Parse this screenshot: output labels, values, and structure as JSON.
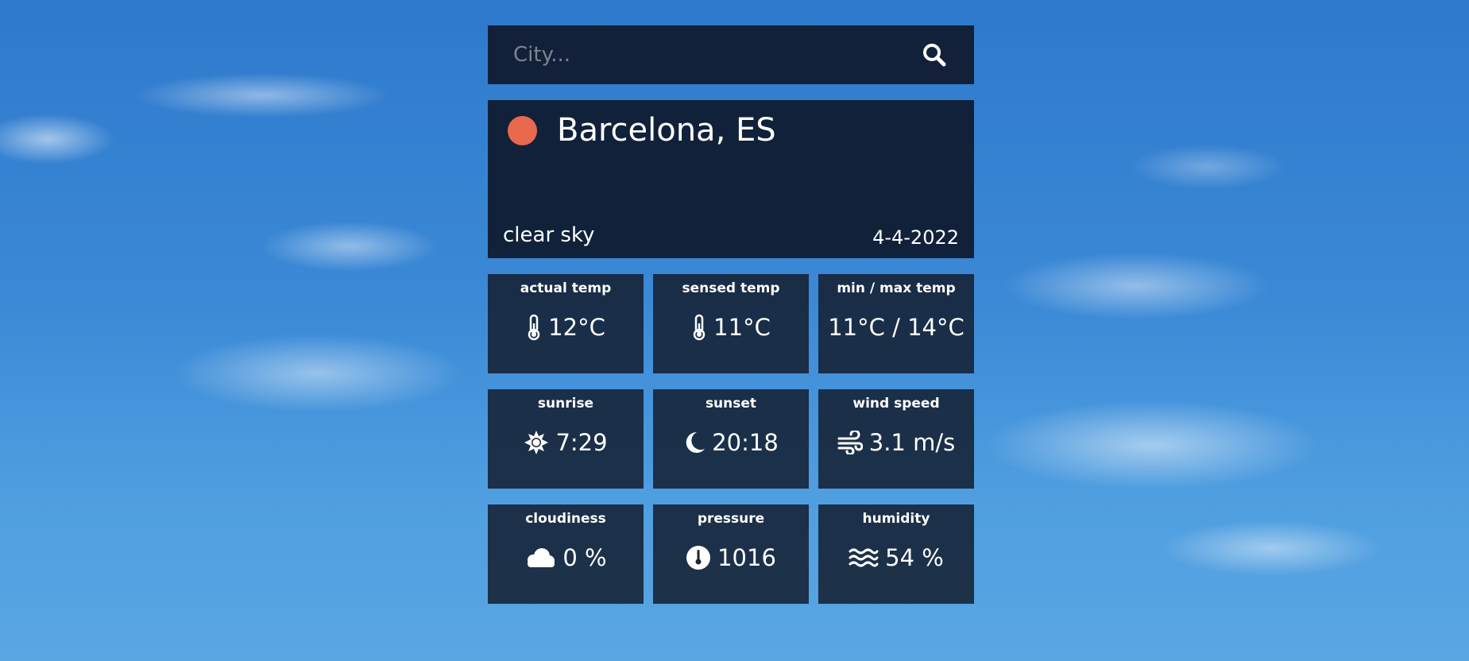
{
  "search": {
    "placeholder": "City...",
    "icon": "search-icon"
  },
  "current": {
    "city": "Barcelona, ES",
    "description": "clear sky",
    "date": "4-4-2022",
    "status_color": "#e8694d"
  },
  "tiles": [
    {
      "label": "actual temp",
      "value": "12°C",
      "icon": "thermometer-icon"
    },
    {
      "label": "sensed temp",
      "value": "11°C",
      "icon": "thermometer-icon"
    },
    {
      "label": "min / max temp",
      "value": "11°C / 14°C",
      "icon": ""
    },
    {
      "label": "sunrise",
      "value": "7:29",
      "icon": "sun-icon"
    },
    {
      "label": "sunset",
      "value": "20:18",
      "icon": "moon-icon"
    },
    {
      "label": "wind speed",
      "value": "3.1 m/s",
      "icon": "wind-icon"
    },
    {
      "label": "cloudiness",
      "value": "0 %",
      "icon": "cloud-icon"
    },
    {
      "label": "pressure",
      "value": "1016",
      "icon": "gauge-icon"
    },
    {
      "label": "humidity",
      "value": "54 %",
      "icon": "water-icon"
    }
  ]
}
